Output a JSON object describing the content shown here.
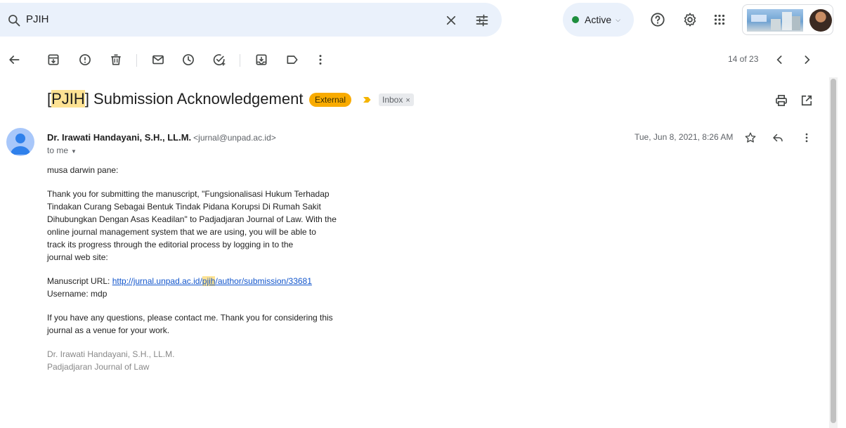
{
  "search": {
    "query": "PJIH"
  },
  "status": {
    "label": "Active",
    "color": "#1e8e3e"
  },
  "toolbar": {
    "pager": "14 of 23"
  },
  "email": {
    "subject_highlight": "PJIH",
    "subject_rest": " Submission Acknowledgement",
    "badge_external": "External",
    "label_inbox": "Inbox",
    "label_remove": "×",
    "sender_name": "Dr. Irawati Handayani, S.H., LL.M.",
    "sender_email": "<jurnal@unpad.ac.id>",
    "to": "to me",
    "date": "Tue, Jun 8, 2021, 8:26 AM",
    "greeting": "musa darwin pane:",
    "para1_lines": [
      "Thank you for submitting the manuscript, \"Fungsionalisasi Hukum Terhadap",
      "Tindakan Curang Sebagai Bentuk Tindak Pidana Korupsi Di Rumah Sakit",
      "Dihubungkan Dengan Asas Keadilan\" to Padjadjaran Journal of Law. With the",
      "online journal management system that we are using, you will be able to",
      "track its progress through the editorial process by logging in to the",
      "journal web site:"
    ],
    "manuscript_label": "Manuscript URL: ",
    "url_before": "http://jurnal.unpad.ac.id/",
    "url_highlight": "pjih",
    "url_after": "/author/submission/33681",
    "username": "Username: mdp",
    "para3_lines": [
      "If you have any questions, please contact me. Thank you for considering this",
      "journal as a venue for your work."
    ],
    "signature_name": "Dr. Irawati Handayani, S.H., LL.M.",
    "signature_org": "Padjadjaran Journal of Law"
  },
  "colors": {
    "highlight": "#fde293",
    "external_badge": "#f9ab00",
    "link": "#1155cc",
    "search_bg": "#eaf1fb"
  }
}
